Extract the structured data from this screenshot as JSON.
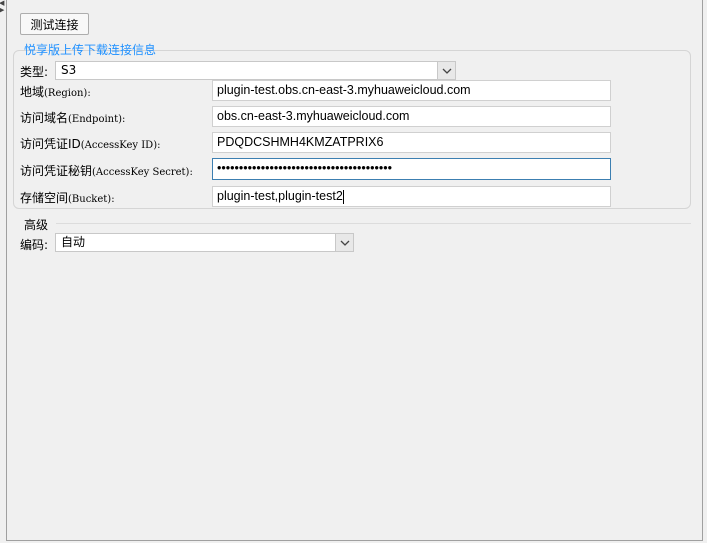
{
  "toolbar": {
    "test_button_label": "测试连接"
  },
  "group": {
    "title": "悦享版上传下载连接信息",
    "type_label_cn": "类型:",
    "type_value": "S3",
    "region_label_cn": "地域",
    "region_label_en": "(Region):",
    "region_value": "plugin-test.obs.cn-east-3.myhuaweicloud.com",
    "endpoint_label_cn": "访问域名",
    "endpoint_label_en": "(Endpoint):",
    "endpoint_value": "obs.cn-east-3.myhuaweicloud.com",
    "akid_label_cn": "访问凭证ID",
    "akid_label_en": "(AccessKey ID):",
    "akid_value": "PDQDCSHMH4KMZATPRIX6",
    "secret_label_cn": "访问凭证秘钥",
    "secret_label_en": "(AccessKey Secret):",
    "secret_value": "••••••••••••••••••••••••••••••••••••••••",
    "bucket_label_cn": "存储空间",
    "bucket_label_en": "(Bucket):",
    "bucket_value": "plugin-test,plugin-test2"
  },
  "advanced": {
    "title": "高级",
    "encoding_label": "编码:",
    "encoding_value": "自动"
  }
}
